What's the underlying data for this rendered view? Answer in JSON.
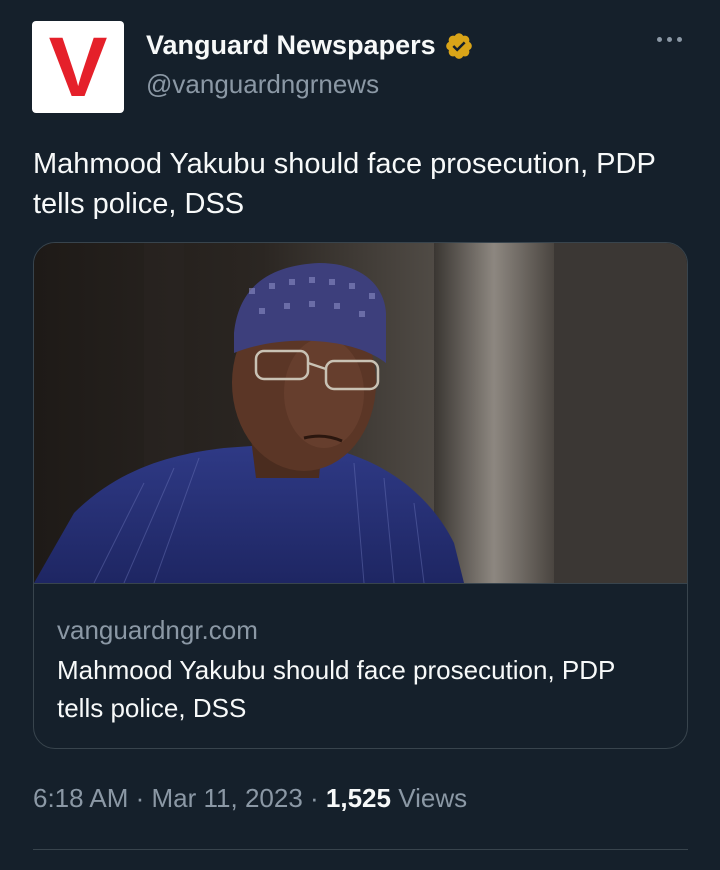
{
  "account": {
    "avatar_letter": "V",
    "display_name": "Vanguard Newspapers",
    "handle": "@vanguardngrnews",
    "verified_color": "#d9a418"
  },
  "tweet": {
    "text": "Mahmood Yakubu should face prosecution, PDP tells police, DSS"
  },
  "card": {
    "domain": "vanguardngr.com",
    "title": "Mahmood Yakubu should face prosecution, PDP tells police, DSS"
  },
  "meta": {
    "time": "6:18 AM",
    "separator": " · ",
    "date": "Mar 11, 2023",
    "views_count": "1,525",
    "views_label": " Views"
  },
  "colors": {
    "background": "#15202b",
    "text_primary": "#f7f9f9",
    "text_secondary": "#8b98a5",
    "border": "#38444d",
    "brand_red": "#e5202a"
  },
  "icons": {
    "verified": "verified-badge-icon",
    "more": "more-options-icon"
  }
}
